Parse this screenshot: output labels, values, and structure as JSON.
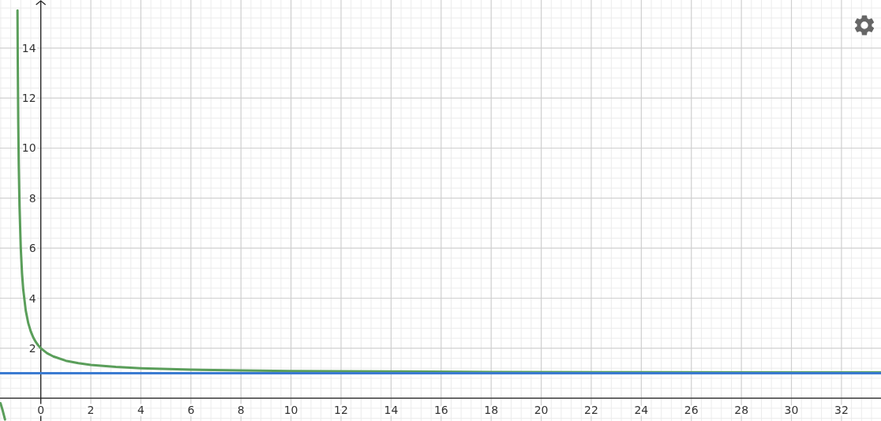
{
  "graph": {
    "chart_data": {
      "type": "line",
      "x": [
        -1.61,
        -1.52,
        -1.43,
        -1,
        -0.931,
        -0.92,
        -0.9,
        -0.88,
        -0.85,
        -0.8,
        -0.75,
        -0.7,
        -0.6,
        -0.5,
        -0.4,
        -0.3,
        -0.2,
        -0.1,
        0,
        0.25,
        0.5,
        1,
        1.5,
        2,
        3,
        4,
        6,
        8,
        10,
        14,
        18,
        24,
        33.58
      ],
      "series": [
        {
          "color": "#5a9e5a",
          "values": [
            -0.2,
            -0.5,
            -0.85,
            null,
            15.5,
            13.5,
            11,
            9.33,
            7.67,
            6,
            5,
            4.33,
            3.5,
            3,
            2.67,
            2.43,
            2.25,
            2.11,
            2,
            1.8,
            1.67,
            1.5,
            1.4,
            1.33,
            1.25,
            1.2,
            1.14,
            1.11,
            1.09,
            1.07,
            1.05,
            1.04,
            1.03
          ]
        },
        {
          "color": "#3b7bd1",
          "values": [
            1,
            1,
            1,
            1,
            1,
            1,
            1,
            1,
            1,
            1,
            1,
            1,
            1,
            1,
            1,
            1,
            1,
            1,
            1,
            1,
            1,
            1,
            1,
            1,
            1,
            1,
            1,
            1,
            1,
            1,
            1,
            1,
            1
          ]
        }
      ],
      "grid": true,
      "xlim": [
        -1.63,
        33.58
      ],
      "ylim": [
        -0.91,
        15.92
      ],
      "xticks": [
        0,
        2,
        4,
        6,
        8,
        10,
        12,
        14,
        16,
        18,
        20,
        22,
        24,
        26,
        28,
        30,
        32
      ],
      "yticks": [
        2,
        4,
        6,
        8,
        10,
        12,
        14
      ]
    }
  }
}
